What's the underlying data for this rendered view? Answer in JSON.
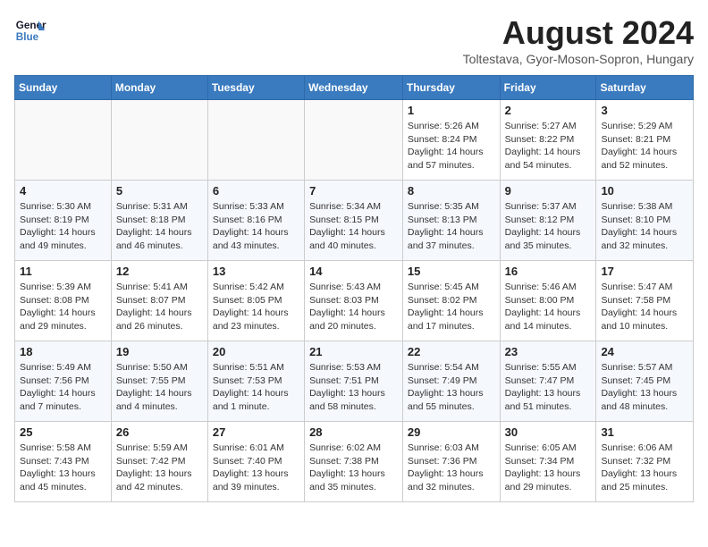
{
  "header": {
    "logo_line1": "General",
    "logo_line2": "Blue",
    "month_year": "August 2024",
    "location": "Toltestava, Gyor-Moson-Sopron, Hungary"
  },
  "weekdays": [
    "Sunday",
    "Monday",
    "Tuesday",
    "Wednesday",
    "Thursday",
    "Friday",
    "Saturday"
  ],
  "weeks": [
    [
      {
        "day": "",
        "info": ""
      },
      {
        "day": "",
        "info": ""
      },
      {
        "day": "",
        "info": ""
      },
      {
        "day": "",
        "info": ""
      },
      {
        "day": "1",
        "info": "Sunrise: 5:26 AM\nSunset: 8:24 PM\nDaylight: 14 hours\nand 57 minutes."
      },
      {
        "day": "2",
        "info": "Sunrise: 5:27 AM\nSunset: 8:22 PM\nDaylight: 14 hours\nand 54 minutes."
      },
      {
        "day": "3",
        "info": "Sunrise: 5:29 AM\nSunset: 8:21 PM\nDaylight: 14 hours\nand 52 minutes."
      }
    ],
    [
      {
        "day": "4",
        "info": "Sunrise: 5:30 AM\nSunset: 8:19 PM\nDaylight: 14 hours\nand 49 minutes."
      },
      {
        "day": "5",
        "info": "Sunrise: 5:31 AM\nSunset: 8:18 PM\nDaylight: 14 hours\nand 46 minutes."
      },
      {
        "day": "6",
        "info": "Sunrise: 5:33 AM\nSunset: 8:16 PM\nDaylight: 14 hours\nand 43 minutes."
      },
      {
        "day": "7",
        "info": "Sunrise: 5:34 AM\nSunset: 8:15 PM\nDaylight: 14 hours\nand 40 minutes."
      },
      {
        "day": "8",
        "info": "Sunrise: 5:35 AM\nSunset: 8:13 PM\nDaylight: 14 hours\nand 37 minutes."
      },
      {
        "day": "9",
        "info": "Sunrise: 5:37 AM\nSunset: 8:12 PM\nDaylight: 14 hours\nand 35 minutes."
      },
      {
        "day": "10",
        "info": "Sunrise: 5:38 AM\nSunset: 8:10 PM\nDaylight: 14 hours\nand 32 minutes."
      }
    ],
    [
      {
        "day": "11",
        "info": "Sunrise: 5:39 AM\nSunset: 8:08 PM\nDaylight: 14 hours\nand 29 minutes."
      },
      {
        "day": "12",
        "info": "Sunrise: 5:41 AM\nSunset: 8:07 PM\nDaylight: 14 hours\nand 26 minutes."
      },
      {
        "day": "13",
        "info": "Sunrise: 5:42 AM\nSunset: 8:05 PM\nDaylight: 14 hours\nand 23 minutes."
      },
      {
        "day": "14",
        "info": "Sunrise: 5:43 AM\nSunset: 8:03 PM\nDaylight: 14 hours\nand 20 minutes."
      },
      {
        "day": "15",
        "info": "Sunrise: 5:45 AM\nSunset: 8:02 PM\nDaylight: 14 hours\nand 17 minutes."
      },
      {
        "day": "16",
        "info": "Sunrise: 5:46 AM\nSunset: 8:00 PM\nDaylight: 14 hours\nand 14 minutes."
      },
      {
        "day": "17",
        "info": "Sunrise: 5:47 AM\nSunset: 7:58 PM\nDaylight: 14 hours\nand 10 minutes."
      }
    ],
    [
      {
        "day": "18",
        "info": "Sunrise: 5:49 AM\nSunset: 7:56 PM\nDaylight: 14 hours\nand 7 minutes."
      },
      {
        "day": "19",
        "info": "Sunrise: 5:50 AM\nSunset: 7:55 PM\nDaylight: 14 hours\nand 4 minutes."
      },
      {
        "day": "20",
        "info": "Sunrise: 5:51 AM\nSunset: 7:53 PM\nDaylight: 14 hours\nand 1 minute."
      },
      {
        "day": "21",
        "info": "Sunrise: 5:53 AM\nSunset: 7:51 PM\nDaylight: 13 hours\nand 58 minutes."
      },
      {
        "day": "22",
        "info": "Sunrise: 5:54 AM\nSunset: 7:49 PM\nDaylight: 13 hours\nand 55 minutes."
      },
      {
        "day": "23",
        "info": "Sunrise: 5:55 AM\nSunset: 7:47 PM\nDaylight: 13 hours\nand 51 minutes."
      },
      {
        "day": "24",
        "info": "Sunrise: 5:57 AM\nSunset: 7:45 PM\nDaylight: 13 hours\nand 48 minutes."
      }
    ],
    [
      {
        "day": "25",
        "info": "Sunrise: 5:58 AM\nSunset: 7:43 PM\nDaylight: 13 hours\nand 45 minutes."
      },
      {
        "day": "26",
        "info": "Sunrise: 5:59 AM\nSunset: 7:42 PM\nDaylight: 13 hours\nand 42 minutes."
      },
      {
        "day": "27",
        "info": "Sunrise: 6:01 AM\nSunset: 7:40 PM\nDaylight: 13 hours\nand 39 minutes."
      },
      {
        "day": "28",
        "info": "Sunrise: 6:02 AM\nSunset: 7:38 PM\nDaylight: 13 hours\nand 35 minutes."
      },
      {
        "day": "29",
        "info": "Sunrise: 6:03 AM\nSunset: 7:36 PM\nDaylight: 13 hours\nand 32 minutes."
      },
      {
        "day": "30",
        "info": "Sunrise: 6:05 AM\nSunset: 7:34 PM\nDaylight: 13 hours\nand 29 minutes."
      },
      {
        "day": "31",
        "info": "Sunrise: 6:06 AM\nSunset: 7:32 PM\nDaylight: 13 hours\nand 25 minutes."
      }
    ]
  ]
}
